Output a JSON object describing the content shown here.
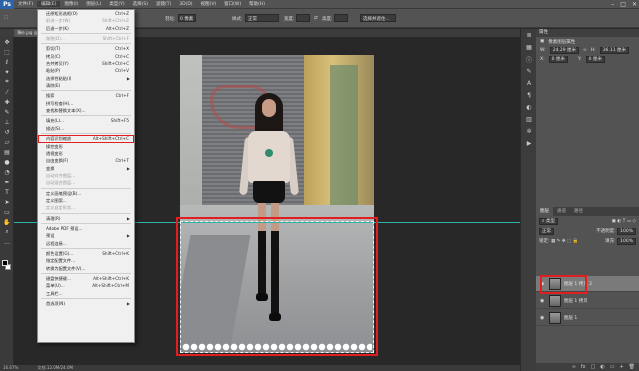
{
  "menubar": {
    "logo": "Ps",
    "items": [
      "文件(F)",
      "编辑(E)",
      "图像(I)",
      "图层(L)",
      "类型(Y)",
      "选择(S)",
      "滤镜(T)",
      "3D(D)",
      "视图(V)",
      "窗口(W)",
      "帮助(H)"
    ],
    "window_buttons": [
      "–",
      "□",
      "✕"
    ]
  },
  "options": {
    "feather_label": "羽化:",
    "feather_value": "0 像素",
    "style_label": "样式:",
    "style_value": "正常",
    "width_label": "宽度:",
    "height_label": "高度:",
    "refine_button": "选择并遮住..."
  },
  "document": {
    "tab_label": "薄纱.jpg @ ..."
  },
  "edit_menu": {
    "items": [
      {
        "label": "还原矩形选框(O)",
        "shortcut": "Ctrl+Z",
        "disabled": false,
        "submenu": false
      },
      {
        "label": "前进一步(W)",
        "shortcut": "Shift+Ctrl+Z",
        "disabled": true,
        "submenu": false
      },
      {
        "label": "后退一步(K)",
        "shortcut": "Alt+Ctrl+Z",
        "disabled": false,
        "submenu": false
      },
      {
        "sep": true
      },
      {
        "label": "渐隐(D)...",
        "shortcut": "Shift+Ctrl+F",
        "disabled": true,
        "submenu": false
      },
      {
        "sep": true
      },
      {
        "label": "剪切(T)",
        "shortcut": "Ctrl+X",
        "disabled": false,
        "submenu": false
      },
      {
        "label": "拷贝(C)",
        "shortcut": "Ctrl+C",
        "disabled": false,
        "submenu": false
      },
      {
        "label": "合并拷贝(Y)",
        "shortcut": "Shift+Ctrl+C",
        "disabled": false,
        "submenu": false
      },
      {
        "label": "粘贴(P)",
        "shortcut": "Ctrl+V",
        "disabled": false,
        "submenu": false
      },
      {
        "label": "选择性粘贴(I)",
        "shortcut": "",
        "disabled": false,
        "submenu": true
      },
      {
        "label": "清除(E)",
        "shortcut": "",
        "disabled": false,
        "submenu": false
      },
      {
        "sep": true
      },
      {
        "label": "搜索",
        "shortcut": "Ctrl+F",
        "disabled": false,
        "submenu": false
      },
      {
        "label": "拼写检查(H)...",
        "shortcut": "",
        "disabled": false,
        "submenu": false
      },
      {
        "label": "查找和替换文本(X)...",
        "shortcut": "",
        "disabled": false,
        "submenu": false
      },
      {
        "sep": true
      },
      {
        "label": "填充(L)...",
        "shortcut": "Shift+F5",
        "disabled": false,
        "submenu": false
      },
      {
        "label": "描边(S)...",
        "shortcut": "",
        "disabled": false,
        "submenu": false
      },
      {
        "sep": true
      },
      {
        "label": "内容识别缩放",
        "shortcut": "Alt+Shift+Ctrl+C",
        "disabled": false,
        "submenu": false,
        "highlight": true
      },
      {
        "label": "操控变形",
        "shortcut": "",
        "disabled": false,
        "submenu": false
      },
      {
        "label": "透视变形",
        "shortcut": "",
        "disabled": false,
        "submenu": false
      },
      {
        "label": "自由变换(F)",
        "shortcut": "Ctrl+T",
        "disabled": false,
        "submenu": false
      },
      {
        "label": "变换",
        "shortcut": "",
        "disabled": false,
        "submenu": true
      },
      {
        "label": "自动对齐图层...",
        "shortcut": "",
        "disabled": true,
        "submenu": false
      },
      {
        "label": "自动混合图层...",
        "shortcut": "",
        "disabled": true,
        "submenu": false
      },
      {
        "sep": true
      },
      {
        "label": "定义画笔预设(B)...",
        "shortcut": "",
        "disabled": false,
        "submenu": false
      },
      {
        "label": "定义图案...",
        "shortcut": "",
        "disabled": false,
        "submenu": false
      },
      {
        "label": "定义自定形状...",
        "shortcut": "",
        "disabled": true,
        "submenu": false
      },
      {
        "sep": true
      },
      {
        "label": "清理(R)",
        "shortcut": "",
        "disabled": false,
        "submenu": true
      },
      {
        "sep": true
      },
      {
        "label": "Adobe PDF 预设...",
        "shortcut": "",
        "disabled": false,
        "submenu": false
      },
      {
        "label": "预设",
        "shortcut": "",
        "disabled": false,
        "submenu": true
      },
      {
        "label": "远程连接...",
        "shortcut": "",
        "disabled": false,
        "submenu": false
      },
      {
        "sep": true
      },
      {
        "label": "颜色设置(G)...",
        "shortcut": "Shift+Ctrl+K",
        "disabled": false,
        "submenu": false
      },
      {
        "label": "指定配置文件...",
        "shortcut": "",
        "disabled": false,
        "submenu": false
      },
      {
        "label": "转换为配置文件(V)...",
        "shortcut": "",
        "disabled": false,
        "submenu": false
      },
      {
        "sep": true
      },
      {
        "label": "键盘快捷键...",
        "shortcut": "Alt+Shift+Ctrl+K",
        "disabled": false,
        "submenu": false
      },
      {
        "label": "菜单(U)...",
        "shortcut": "Alt+Shift+Ctrl+M",
        "disabled": false,
        "submenu": false
      },
      {
        "label": "工具栏...",
        "shortcut": "",
        "disabled": false,
        "submenu": false
      },
      {
        "sep": true
      },
      {
        "label": "首选项(N)",
        "shortcut": "",
        "disabled": false,
        "submenu": true
      }
    ]
  },
  "status": {
    "zoom": "16.67%",
    "doc_info": "文档:12.0M/24.0M"
  },
  "properties": {
    "title": "属性",
    "subtitle": "像素图层属性",
    "w_label": "W:",
    "w_value": "24.29 厘米",
    "h_label": "H:",
    "h_value": "36.11 厘米",
    "x_label": "X:",
    "x_value": "0 厘米",
    "y_label": "Y:",
    "y_value": "0 厘米"
  },
  "layers": {
    "tabs": [
      "图层",
      "通道",
      "路径"
    ],
    "kind_label": "类型",
    "blend_mode": "正常",
    "opacity_label": "不透明度:",
    "opacity_value": "100%",
    "lock_label": "锁定:",
    "fill_label": "填充:",
    "fill_value": "100%",
    "rows": [
      {
        "name": "图层 1 拷贝 2",
        "selected": true
      },
      {
        "name": "图层 1 拷贝",
        "selected": false
      },
      {
        "name": "图层 1",
        "selected": false
      }
    ],
    "footer_icons": [
      "fx",
      "□",
      "◐",
      "▭",
      "+",
      "🗑"
    ]
  },
  "colors": {
    "accent_red": "#e02020",
    "guide": "#2fb3a3",
    "menu_bg": "#f0f0f0"
  }
}
